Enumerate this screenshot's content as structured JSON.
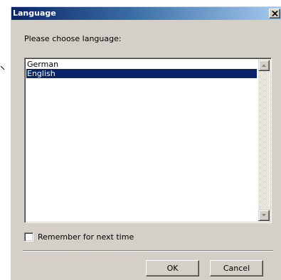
{
  "window": {
    "title": "Language"
  },
  "dialog": {
    "prompt": "Please choose language:",
    "languages": [
      {
        "label": "German",
        "selected": false
      },
      {
        "label": "English",
        "selected": true
      }
    ],
    "remember": {
      "label": "Remember for next time",
      "checked": false
    },
    "ok_label": "OK",
    "cancel_label": "Cancel"
  },
  "icons": {
    "close": "close-icon",
    "scroll_up": "arrow-up-icon",
    "scroll_down": "arrow-down-icon"
  },
  "colors": {
    "title_start": "#0a246a",
    "title_end": "#a6caf0",
    "selection": "#0a246a",
    "face": "#d4d0c8"
  }
}
